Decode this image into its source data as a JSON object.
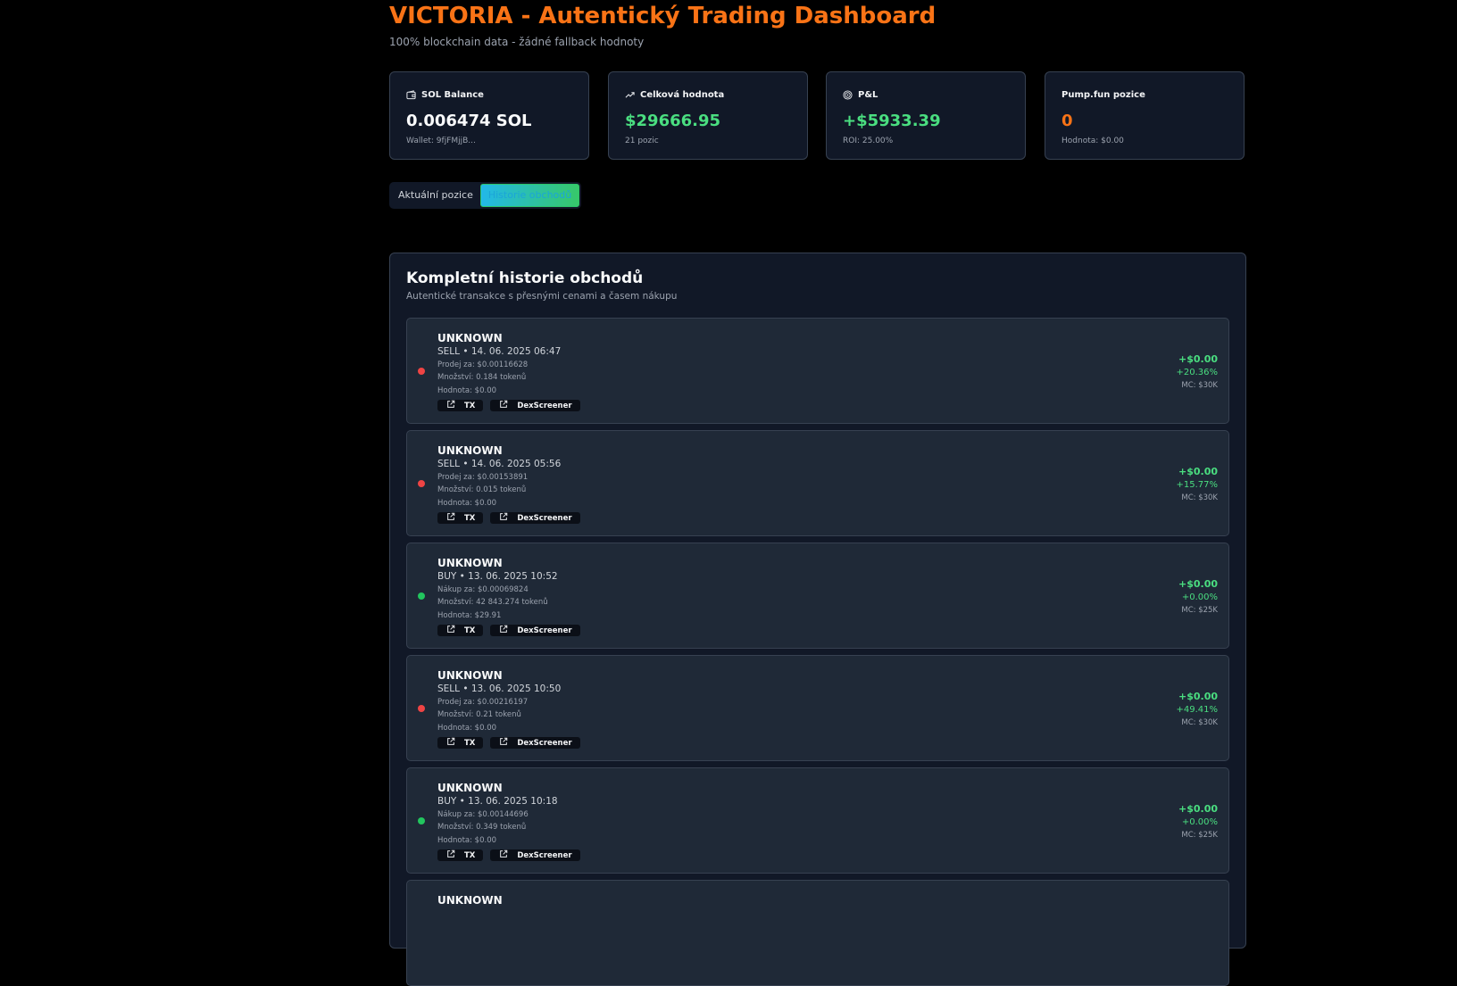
{
  "header": {
    "title": "VICTORIA - Autentický Trading Dashboard",
    "subtitle": "100% blockchain data - žádné fallback hodnoty"
  },
  "colors": {
    "accent": "#f97316",
    "positive": "#4ade80",
    "sell_dot": "#ef4444",
    "buy_dot": "#22c55e"
  },
  "cards": [
    {
      "icon": "wallet-icon",
      "label": "SOL Balance",
      "value": "0.006474 SOL",
      "sub": "Wallet: 9fjFMjjB...",
      "value_color": "#f9fafb"
    },
    {
      "icon": "trending-up-icon",
      "label": "Celková hodnota",
      "value": "$29666.95",
      "sub": "21 pozic",
      "value_color": "#4ade80"
    },
    {
      "icon": "target-icon",
      "label": "P&L",
      "value": "+$5933.39",
      "sub": "ROI: 25.00%",
      "value_color": "#4ade80"
    },
    {
      "icon": "",
      "label": "Pump.fun pozice",
      "value": "0",
      "sub": "Hodnota: $0.00",
      "value_color": "#f97316"
    }
  ],
  "tabs": [
    {
      "label": "Aktuální pozice",
      "active": false
    },
    {
      "label": "Historie obchodů",
      "active": true
    }
  ],
  "history": {
    "title": "Kompletní historie obchodů",
    "subtitle": "Autentické transakce s přesnými cenami a časem nákupu",
    "link_tx": "TX",
    "link_dex": "DexScreener",
    "trades": [
      {
        "name": "UNKNOWN",
        "side": "SELL",
        "line": "SELL • 14. 06. 2025 06:47",
        "price": "Prodej za: $0.00116628",
        "qty": "Množství: 0.184 tokenů",
        "value": "Hodnota: $0.00",
        "pnl": "+$0.00",
        "pct": "+20.36%",
        "mc": "MC: $30K"
      },
      {
        "name": "UNKNOWN",
        "side": "SELL",
        "line": "SELL • 14. 06. 2025 05:56",
        "price": "Prodej za: $0.00153891",
        "qty": "Množství: 0.015 tokenů",
        "value": "Hodnota: $0.00",
        "pnl": "+$0.00",
        "pct": "+15.77%",
        "mc": "MC: $30K"
      },
      {
        "name": "UNKNOWN",
        "side": "BUY",
        "line": "BUY • 13. 06. 2025 10:52",
        "price": "Nákup za: $0.00069824",
        "qty": "Množství: 42 843.274 tokenů",
        "value": "Hodnota: $29.91",
        "pnl": "+$0.00",
        "pct": "+0.00%",
        "mc": "MC: $25K"
      },
      {
        "name": "UNKNOWN",
        "side": "SELL",
        "line": "SELL • 13. 06. 2025 10:50",
        "price": "Prodej za: $0.00216197",
        "qty": "Množství: 0.21 tokenů",
        "value": "Hodnota: $0.00",
        "pnl": "+$0.00",
        "pct": "+49.41%",
        "mc": "MC: $30K"
      },
      {
        "name": "UNKNOWN",
        "side": "BUY",
        "line": "BUY • 13. 06. 2025 10:18",
        "price": "Nákup za: $0.00144696",
        "qty": "Množství: 0.349 tokenů",
        "value": "Hodnota: $0.00",
        "pnl": "+$0.00",
        "pct": "+0.00%",
        "mc": "MC: $25K"
      },
      {
        "name": "UNKNOWN",
        "side": "",
        "line": "",
        "price": "",
        "qty": "",
        "value": "",
        "pnl": "",
        "pct": "",
        "mc": ""
      }
    ]
  }
}
